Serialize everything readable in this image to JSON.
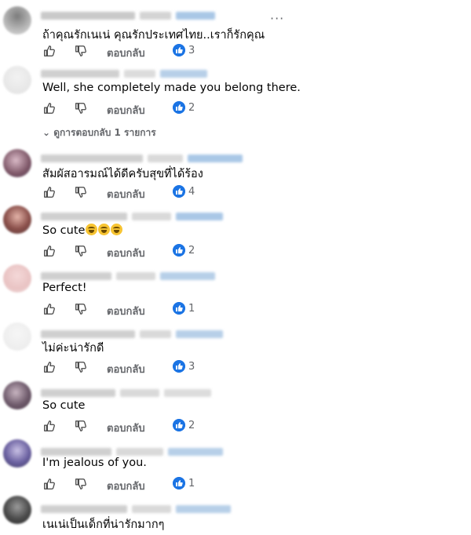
{
  "more_menu": "···",
  "view_replies": "⌄  ดูการตอบกลับ 1 รายการ",
  "reply_label": "ตอบกลับ",
  "colors": {
    "reaction_badge": "#1b74e4",
    "meta_text": "#65676b"
  },
  "icons": {
    "like": "thumbs-up-icon",
    "dislike": "thumbs-down-icon",
    "reaction": "like-reaction-icon"
  },
  "comments": [
    {
      "text": "ถ้าคุณรักเนเน่ คุณรักประเทศไทย..เราก็รักคุณ",
      "reactions": "3"
    },
    {
      "text": "Well, she completely made you belong there.",
      "reactions": "2"
    },
    {
      "text": "สัมผัสอารมณ์ได้ดีครับสุขที่ได้ร้อง",
      "reactions": "4"
    },
    {
      "text": "So cute",
      "emoji": [
        "grinning-emoji",
        "grinning-emoji",
        "grinning-emoji"
      ],
      "reactions": "2"
    },
    {
      "text": "Perfect!",
      "reactions": "1"
    },
    {
      "text": "ไม่ค่ะน่ารักดี",
      "reactions": "3"
    },
    {
      "text": "So cute",
      "reactions": "2"
    },
    {
      "text": "I'm jealous of you.",
      "reactions": "1"
    },
    {
      "text": "เนเน่เป็นเด็กที่น่ารักมากๆ"
    }
  ]
}
